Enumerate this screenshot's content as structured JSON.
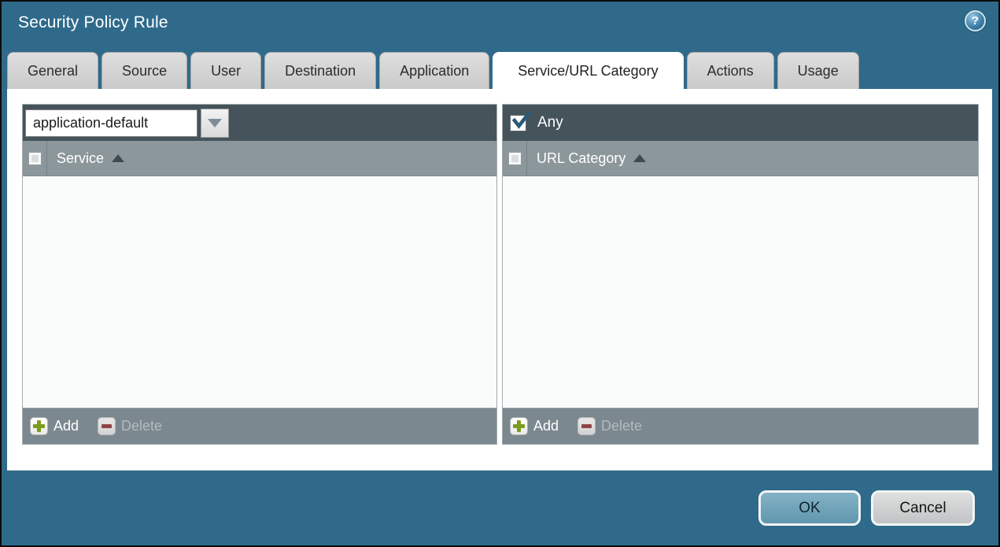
{
  "dialog": {
    "title": "Security Policy Rule",
    "help_glyph": "?"
  },
  "tabs": [
    {
      "label": "General",
      "active": false
    },
    {
      "label": "Source",
      "active": false
    },
    {
      "label": "User",
      "active": false
    },
    {
      "label": "Destination",
      "active": false
    },
    {
      "label": "Application",
      "active": false
    },
    {
      "label": "Service/URL Category",
      "active": true
    },
    {
      "label": "Actions",
      "active": false
    },
    {
      "label": "Usage",
      "active": false
    }
  ],
  "service_panel": {
    "dropdown_value": "application-default",
    "column_header": "Service",
    "sort_order": "ascending",
    "rows": [],
    "add_label": "Add",
    "delete_label": "Delete",
    "delete_enabled": false
  },
  "url_category_panel": {
    "any_label": "Any",
    "any_checked": true,
    "column_header": "URL Category",
    "sort_order": "ascending",
    "rows": [],
    "add_label": "Add",
    "delete_label": "Delete",
    "delete_enabled": false
  },
  "actions": {
    "ok_label": "OK",
    "cancel_label": "Cancel"
  },
  "colors": {
    "background_teal": "#2f6a8b",
    "toolbar_dark": "#45535b",
    "header_row_gray": "#8c979c",
    "footer_row_gray": "#7c888f",
    "add_icon_green": "#7d9c1e",
    "delete_icon_red": "#8e4444",
    "ok_button_blue": "#6fa3ba",
    "checkbox_check": "#2b5876"
  },
  "icons": {
    "help": "question-mark-in-circle",
    "dropdown_arrow": "triangle-down",
    "sort_ascending": "triangle-up",
    "add": "green-plus",
    "delete": "red-minus"
  }
}
